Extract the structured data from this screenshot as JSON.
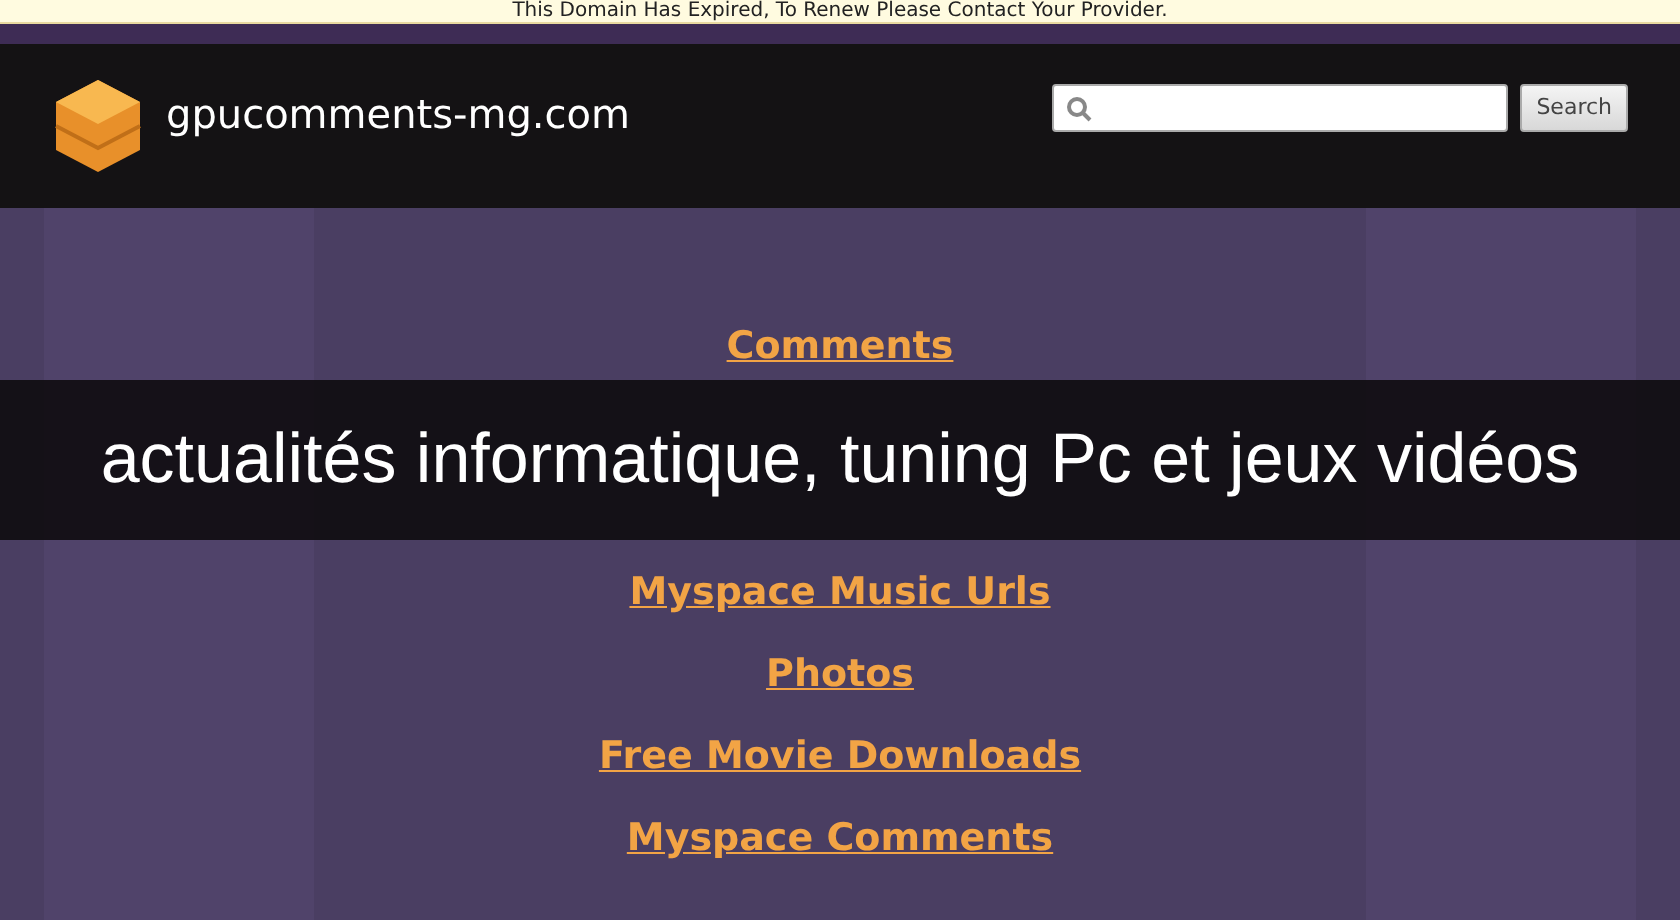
{
  "notice": "This Domain Has Expired, To Renew Please Contact Your Provider.",
  "header": {
    "site_name": "gpucomments-mg.com",
    "search_button": "Search"
  },
  "links_above": [
    "Comments"
  ],
  "banner": "actualités informatique, tuning Pc et jeux vidéos",
  "links_below": [
    "Myspace Music Urls",
    "Photos",
    "Free Movie Downloads",
    "Myspace Comments"
  ]
}
